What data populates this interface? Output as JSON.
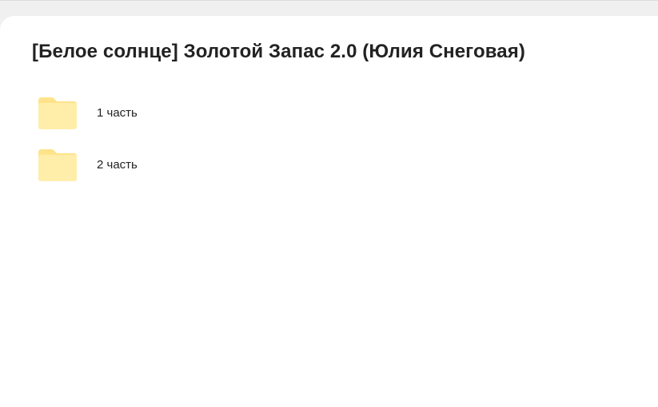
{
  "folder": {
    "title": "[Белое солнце] Золотой Запас 2.0 (Юлия Снеговая)",
    "items": [
      {
        "label": "1 часть",
        "icon": "folder-icon"
      },
      {
        "label": "2 часть",
        "icon": "folder-icon"
      }
    ]
  },
  "colors": {
    "folder_body": "#FFEDAA",
    "folder_tab": "#FFE38A",
    "text": "#222222",
    "background": "#FFFFFF"
  }
}
